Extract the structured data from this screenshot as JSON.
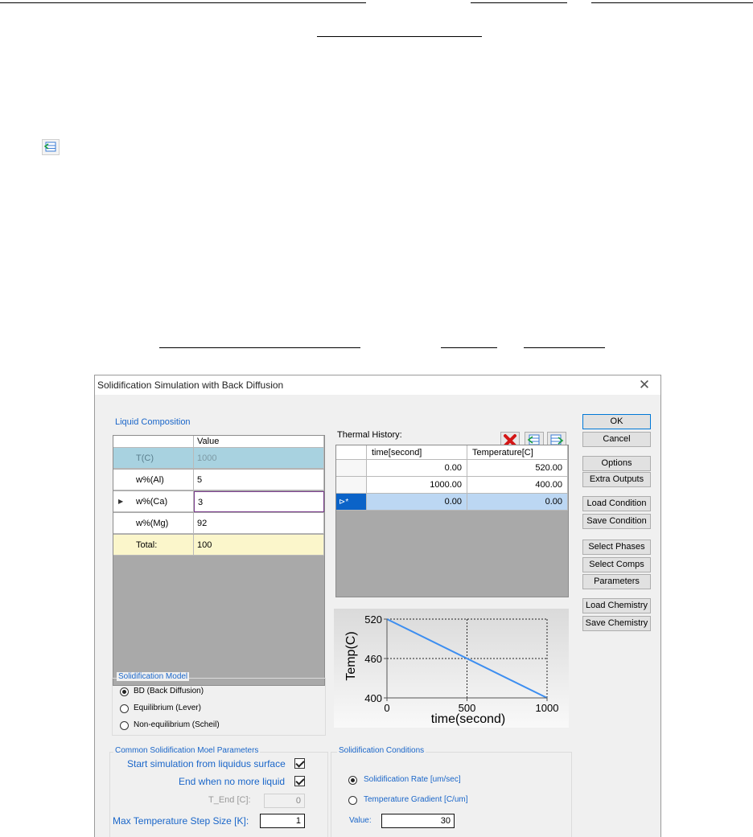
{
  "dialog": {
    "title": "Solidification Simulation with Back Diffusion",
    "close_glyph": "✕"
  },
  "liquid_composition": {
    "label": "Liquid Composition",
    "value_header": "Value",
    "rows": [
      {
        "name": "T(C)",
        "value": "1000"
      },
      {
        "name": "w%(Al)",
        "value": "5"
      },
      {
        "name": "w%(Ca)",
        "value": "3"
      },
      {
        "name": "w%(Mg)",
        "value": "92"
      },
      {
        "name": "Total:",
        "value": "100"
      }
    ],
    "current_row_marker": "▶"
  },
  "thermal_history": {
    "label": "Thermal History:",
    "columns": [
      "time[second]",
      "Temperature[C]"
    ],
    "rows": [
      {
        "time": "0.00",
        "temp": "520.00"
      },
      {
        "time": "1000.00",
        "temp": "400.00"
      },
      {
        "time": "0.00",
        "temp": "0.00"
      }
    ],
    "new_row_marker": "⊳*",
    "icons": [
      "delete-icon",
      "load-table-icon",
      "export-table-icon"
    ]
  },
  "chart_data": {
    "type": "line",
    "title": "",
    "xlabel": "time(second)",
    "ylabel": "Temp(C)",
    "xlim": [
      0,
      1000
    ],
    "ylim": [
      400,
      520
    ],
    "xticks": [
      "0",
      "500",
      "1000"
    ],
    "yticks": [
      "400",
      "460",
      "520"
    ],
    "series": [
      {
        "x": [
          0,
          1000
        ],
        "y": [
          520,
          400
        ]
      }
    ],
    "grid": "dotted",
    "line_color": "#3d8ef0"
  },
  "buttons": {
    "ok": "OK",
    "cancel": "Cancel",
    "options": "Options",
    "extra_outputs": "Extra Outputs",
    "load_condition": "Load Condition",
    "save_condition": "Save Condition",
    "select_phases": "Select Phases",
    "select_comps": "Select Comps",
    "parameters": "Parameters",
    "load_chemistry": "Load Chemistry",
    "save_chemistry": "Save Chemistry"
  },
  "solidification_model": {
    "label": "Solidification Model",
    "options": [
      "BD (Back Diffusion)",
      "Equilibrium (Lever)",
      "Non-equilibrium (Scheil)"
    ],
    "selected": 0
  },
  "common_params": {
    "label": "Common Solidification Moel Parameters",
    "start_from_liquidus": "Start simulation from liquidus surface",
    "end_no_liquid": "End when no more liquid",
    "t_end_label": "T_End [C]:",
    "t_end_value": "0",
    "max_step_label": "Max Temperature Step Size [K]:",
    "max_step_value": "1"
  },
  "solidification_conditions": {
    "label": "Solidification Conditions",
    "options": [
      "Solidification Rate [um/sec]",
      "Temperature Gradient [C/um]"
    ],
    "selected": 0,
    "value_label": "Value:",
    "value": "30"
  }
}
